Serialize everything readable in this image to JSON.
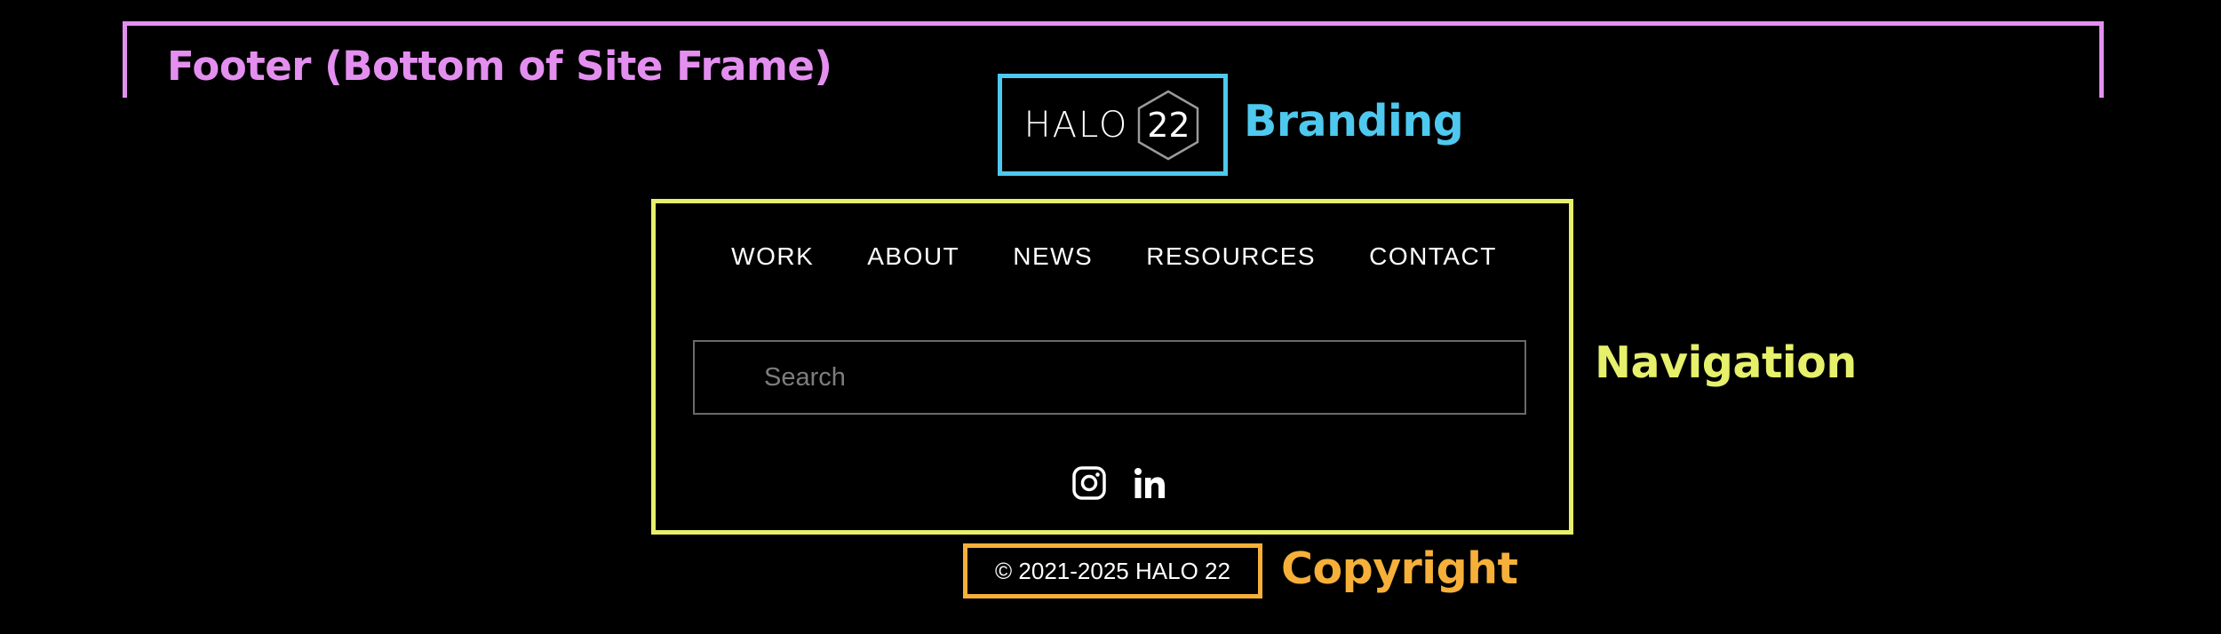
{
  "annotations": {
    "footer_label": "Footer (Bottom of Site Frame)",
    "branding_label": "Branding",
    "navigation_label": "Navigation",
    "copyright_label": "Copyright"
  },
  "branding": {
    "logo_word": "HALO",
    "logo_number": "22",
    "logo_icon": "hexagon-logo-icon"
  },
  "navigation": {
    "links": [
      "WORK",
      "ABOUT",
      "NEWS",
      "RESOURCES",
      "CONTACT"
    ]
  },
  "search": {
    "placeholder": "Search",
    "value": ""
  },
  "social": {
    "icons": [
      "instagram-icon",
      "linkedin-icon"
    ]
  },
  "copyright": {
    "text": "© 2021-2025 HALO 22"
  },
  "colors": {
    "background": "#000000",
    "footer_annotation": "#e48ff0",
    "branding_annotation": "#4ec8ee",
    "navigation_annotation": "#e6f06a",
    "copyright_annotation": "#f6b03a",
    "text": "#ffffff"
  }
}
